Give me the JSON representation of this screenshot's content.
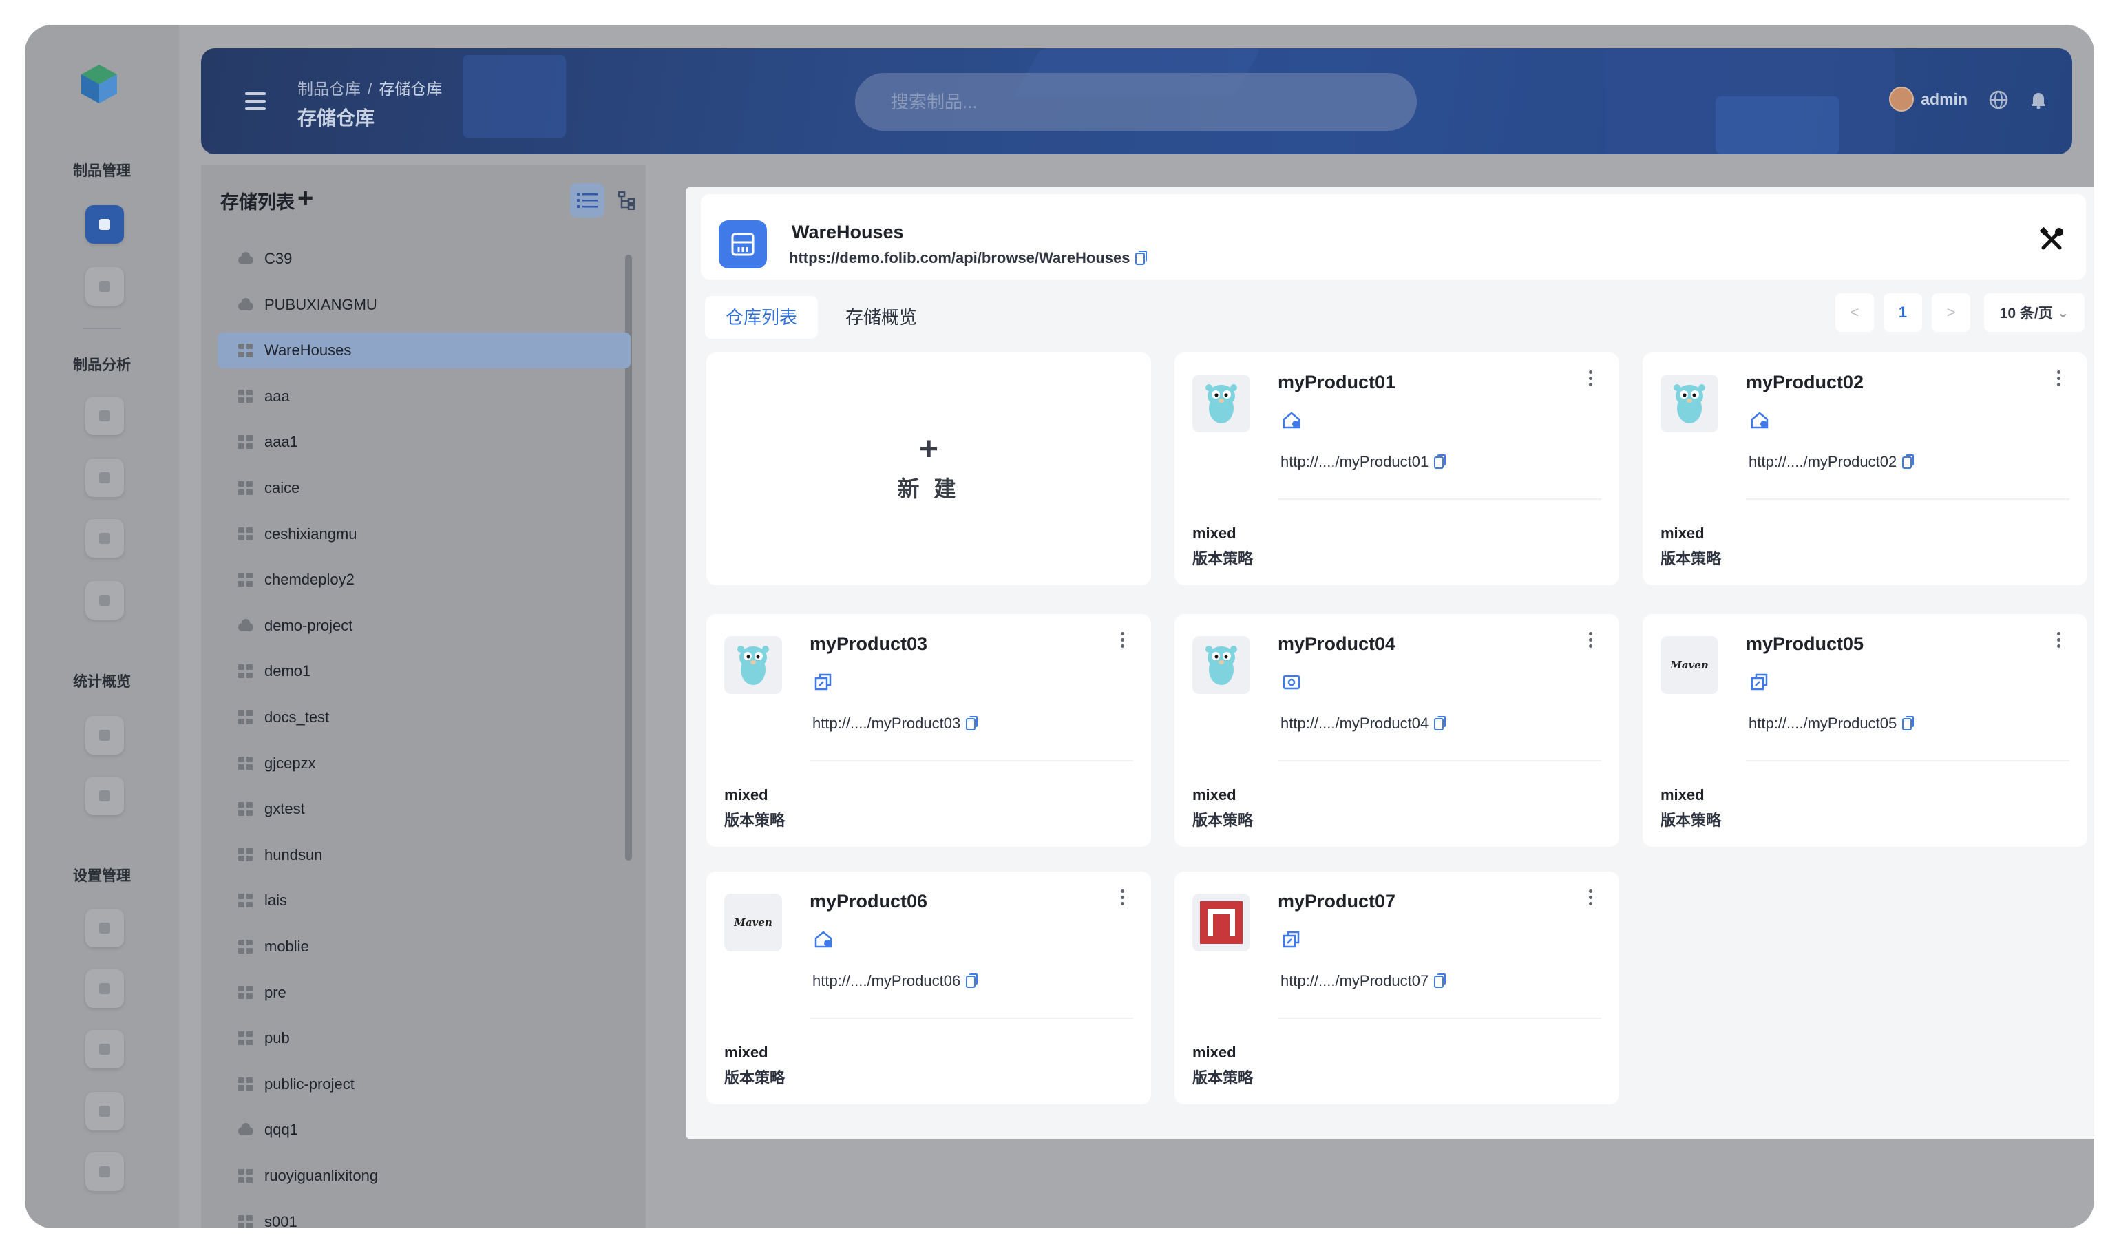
{
  "sidebar": {
    "groups": [
      {
        "label": "制品管理"
      },
      {
        "label": "制品分析"
      },
      {
        "label": "统计概览"
      },
      {
        "label": "设置管理"
      }
    ]
  },
  "header": {
    "breadcrumb": [
      "制品仓库",
      "存储仓库"
    ],
    "breadcrumb_sep": "/",
    "title": "存储仓库",
    "search_placeholder": "搜索制品...",
    "user": "admin"
  },
  "storage_list": {
    "title": "存储列表",
    "add": "+",
    "items": [
      {
        "name": "C39",
        "icon": "cloud-icon"
      },
      {
        "name": "PUBUXIANGMU",
        "icon": "cloud-icon"
      },
      {
        "name": "WareHouses",
        "icon": "grid-icon",
        "selected": true
      },
      {
        "name": "aaa",
        "icon": "grid-icon"
      },
      {
        "name": "aaa1",
        "icon": "grid-icon"
      },
      {
        "name": "caice",
        "icon": "grid-icon"
      },
      {
        "name": "ceshixiangmu",
        "icon": "grid-icon"
      },
      {
        "name": "chemdeploy2",
        "icon": "grid-icon"
      },
      {
        "name": "demo-project",
        "icon": "cloud-icon"
      },
      {
        "name": "demo1",
        "icon": "grid-icon"
      },
      {
        "name": "docs_test",
        "icon": "grid-icon"
      },
      {
        "name": "gjcepzx",
        "icon": "grid-icon"
      },
      {
        "name": "gxtest",
        "icon": "grid-icon"
      },
      {
        "name": "hundsun",
        "icon": "grid-icon"
      },
      {
        "name": "lais",
        "icon": "grid-icon"
      },
      {
        "name": "moblie",
        "icon": "grid-icon"
      },
      {
        "name": "pre",
        "icon": "grid-icon"
      },
      {
        "name": "pub",
        "icon": "grid-icon"
      },
      {
        "name": "public-project",
        "icon": "grid-icon"
      },
      {
        "name": "qqq1",
        "icon": "cloud-icon"
      },
      {
        "name": "ruoyiguanlixitong",
        "icon": "grid-icon"
      },
      {
        "name": "s001",
        "icon": "grid-icon"
      }
    ]
  },
  "warehouse": {
    "name": "WareHouses",
    "url": "https://demo.folib.com/api/browse/WareHouses"
  },
  "tabs": [
    "仓库列表",
    "存储概览"
  ],
  "pagination": {
    "prev": "<",
    "page": "1",
    "next": ">",
    "page_size": "10 条/页"
  },
  "new_card": {
    "plus": "+",
    "label": "新 建"
  },
  "products": [
    {
      "name": "myProduct01",
      "url": "http://..../myProduct01",
      "policy": "mixed",
      "policy_label": "版本策略",
      "logo": "gopher-icon",
      "type_icon": "local-repo-icon"
    },
    {
      "name": "myProduct02",
      "url": "http://..../myProduct02",
      "policy": "mixed",
      "policy_label": "版本策略",
      "logo": "gopher-icon",
      "type_icon": "local-repo-icon"
    },
    {
      "name": "myProduct03",
      "url": "http://..../myProduct03",
      "policy": "mixed",
      "policy_label": "版本策略",
      "logo": "gopher-icon",
      "type_icon": "proxy-repo-icon"
    },
    {
      "name": "myProduct04",
      "url": "http://..../myProduct04",
      "policy": "mixed",
      "policy_label": "版本策略",
      "logo": "gopher-icon",
      "type_icon": "group-repo-icon"
    },
    {
      "name": "myProduct05",
      "url": "http://..../myProduct05",
      "policy": "mixed",
      "policy_label": "版本策略",
      "logo": "maven-logo",
      "logo_text": "Maven",
      "type_icon": "proxy-repo-icon"
    },
    {
      "name": "myProduct06",
      "url": "http://..../myProduct06",
      "policy": "mixed",
      "policy_label": "版本策略",
      "logo": "maven-logo",
      "logo_text": "Maven",
      "type_icon": "local-repo-icon"
    },
    {
      "name": "myProduct07",
      "url": "http://..../myProduct07",
      "policy": "mixed",
      "policy_label": "版本策略",
      "logo": "npm-logo",
      "type_icon": "proxy-repo-icon"
    }
  ],
  "colors": {
    "accent": "#2f6fd6",
    "brand_icon": "#3f7ae8",
    "header": "#2b4a86",
    "npm": "#c8373a",
    "gopher": "#7fd3df"
  }
}
